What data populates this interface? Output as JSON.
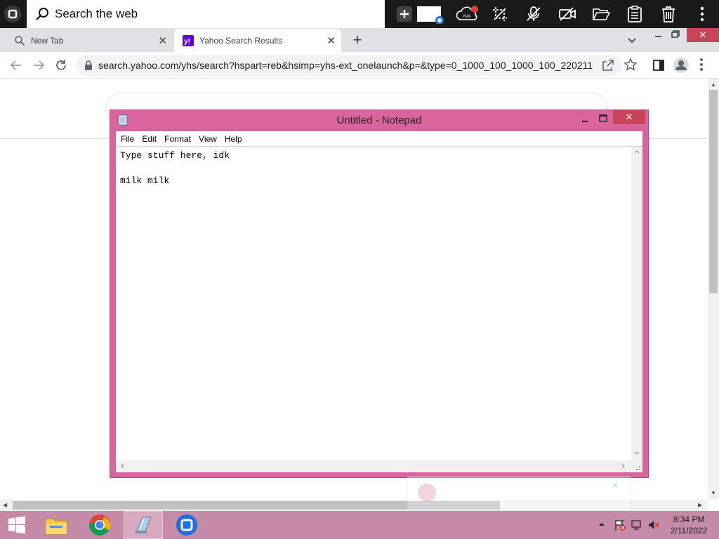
{
  "top_toolbar": {
    "search_label": "Search the web",
    "status_badge": "N/A"
  },
  "tabs": [
    {
      "label": "New Tab",
      "icon": "search-icon"
    },
    {
      "label": "Yahoo Search Results",
      "icon": "yahoo-icon"
    }
  ],
  "address_bar": {
    "url": "search.yahoo.com/yhs/search?hspart=reb&hsimp=yhs-ext_onelaunch&p=&type=0_1000_100_1000_100_220211"
  },
  "notepad": {
    "title": "Untitled - Notepad",
    "menu": [
      "File",
      "Edit",
      "Format",
      "View",
      "Help"
    ],
    "content": "Type stuff here, idk\n\nmilk milk"
  },
  "taskbar": {
    "time": "8:34 PM",
    "date": "2/11/2022"
  },
  "colors": {
    "notepad_frame": "#d9649e",
    "taskbar": "#c48aa8",
    "close_button": "#c7445a"
  }
}
